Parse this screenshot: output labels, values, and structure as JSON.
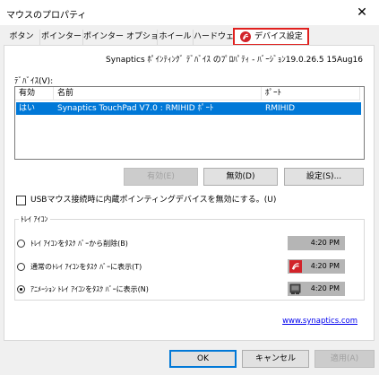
{
  "window": {
    "title": "マウスのプロパティ",
    "close_glyph": "✕"
  },
  "tabs": [
    {
      "label": "ボタン"
    },
    {
      "label": "ポインター"
    },
    {
      "label": "ポインター オプション"
    },
    {
      "label": "ホイール"
    },
    {
      "label": "ハードウェア"
    },
    {
      "label": "デバイス設定",
      "active": true
    }
  ],
  "version_text": "Synaptics ﾎﾟｲﾝﾃｨﾝｸﾞ ﾃﾞﾊﾞｲｽ のﾌﾟﾛﾊﾟﾃｨ - ﾊﾞｰｼﾞｮﾝ19.0.26.5 15Aug16",
  "devices": {
    "label": "ﾃﾞﾊﾞｲｽ(V):",
    "columns": [
      "有効",
      "名前",
      "ﾎﾟｰﾄ"
    ],
    "rows": [
      {
        "enabled": "はい",
        "name": "Synaptics TouchPad V7.0 : RMIHID ﾎﾟｰﾄ",
        "port": "RMIHID"
      }
    ]
  },
  "buttons": {
    "enable": "有効(E)",
    "disable": "無効(D)",
    "settings": "設定(S)..."
  },
  "usb_checkbox": {
    "label": "USBマウス接続時に内蔵ポインティングデバイスを無効にする。(U)",
    "checked": false
  },
  "tray_group": {
    "label": "ﾄﾚｲ ｱｲｺﾝ",
    "options": [
      {
        "label": "ﾄﾚｲ ｱｲｺﾝをﾀｽｸ ﾊﾞｰから削除(B)",
        "selected": false,
        "time": "4:20 PM",
        "icon": "none"
      },
      {
        "label": "通常のﾄﾚｲ ｱｲｺﾝをﾀｽｸ ﾊﾞｰに表示(T)",
        "selected": false,
        "time": "4:20 PM",
        "icon": "synaptics-icon"
      },
      {
        "label": "ｱﾆﾒｰｼｮﾝ ﾄﾚｲ ｱｲｺﾝをﾀｽｸ ﾊﾞｰに表示(N)",
        "selected": true,
        "time": "4:20 PM",
        "icon": "animated-touchpad-icon"
      }
    ]
  },
  "link": "www.synaptics.com",
  "footer": {
    "ok": "OK",
    "cancel": "キャンセル",
    "apply": "適用(A)"
  },
  "colors": {
    "accent": "#0078d7",
    "highlight": "#e0201e",
    "synaptics_red": "#d2232a"
  }
}
